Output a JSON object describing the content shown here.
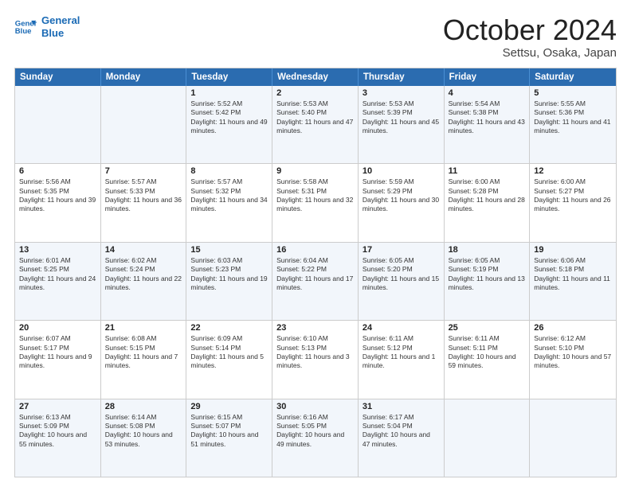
{
  "header": {
    "logo_line1": "General",
    "logo_line2": "Blue",
    "month": "October 2024",
    "location": "Settsu, Osaka, Japan"
  },
  "weekdays": [
    "Sunday",
    "Monday",
    "Tuesday",
    "Wednesday",
    "Thursday",
    "Friday",
    "Saturday"
  ],
  "rows": [
    [
      {
        "day": "",
        "text": ""
      },
      {
        "day": "",
        "text": ""
      },
      {
        "day": "1",
        "text": "Sunrise: 5:52 AM\nSunset: 5:42 PM\nDaylight: 11 hours and 49 minutes."
      },
      {
        "day": "2",
        "text": "Sunrise: 5:53 AM\nSunset: 5:40 PM\nDaylight: 11 hours and 47 minutes."
      },
      {
        "day": "3",
        "text": "Sunrise: 5:53 AM\nSunset: 5:39 PM\nDaylight: 11 hours and 45 minutes."
      },
      {
        "day": "4",
        "text": "Sunrise: 5:54 AM\nSunset: 5:38 PM\nDaylight: 11 hours and 43 minutes."
      },
      {
        "day": "5",
        "text": "Sunrise: 5:55 AM\nSunset: 5:36 PM\nDaylight: 11 hours and 41 minutes."
      }
    ],
    [
      {
        "day": "6",
        "text": "Sunrise: 5:56 AM\nSunset: 5:35 PM\nDaylight: 11 hours and 39 minutes."
      },
      {
        "day": "7",
        "text": "Sunrise: 5:57 AM\nSunset: 5:33 PM\nDaylight: 11 hours and 36 minutes."
      },
      {
        "day": "8",
        "text": "Sunrise: 5:57 AM\nSunset: 5:32 PM\nDaylight: 11 hours and 34 minutes."
      },
      {
        "day": "9",
        "text": "Sunrise: 5:58 AM\nSunset: 5:31 PM\nDaylight: 11 hours and 32 minutes."
      },
      {
        "day": "10",
        "text": "Sunrise: 5:59 AM\nSunset: 5:29 PM\nDaylight: 11 hours and 30 minutes."
      },
      {
        "day": "11",
        "text": "Sunrise: 6:00 AM\nSunset: 5:28 PM\nDaylight: 11 hours and 28 minutes."
      },
      {
        "day": "12",
        "text": "Sunrise: 6:00 AM\nSunset: 5:27 PM\nDaylight: 11 hours and 26 minutes."
      }
    ],
    [
      {
        "day": "13",
        "text": "Sunrise: 6:01 AM\nSunset: 5:25 PM\nDaylight: 11 hours and 24 minutes."
      },
      {
        "day": "14",
        "text": "Sunrise: 6:02 AM\nSunset: 5:24 PM\nDaylight: 11 hours and 22 minutes."
      },
      {
        "day": "15",
        "text": "Sunrise: 6:03 AM\nSunset: 5:23 PM\nDaylight: 11 hours and 19 minutes."
      },
      {
        "day": "16",
        "text": "Sunrise: 6:04 AM\nSunset: 5:22 PM\nDaylight: 11 hours and 17 minutes."
      },
      {
        "day": "17",
        "text": "Sunrise: 6:05 AM\nSunset: 5:20 PM\nDaylight: 11 hours and 15 minutes."
      },
      {
        "day": "18",
        "text": "Sunrise: 6:05 AM\nSunset: 5:19 PM\nDaylight: 11 hours and 13 minutes."
      },
      {
        "day": "19",
        "text": "Sunrise: 6:06 AM\nSunset: 5:18 PM\nDaylight: 11 hours and 11 minutes."
      }
    ],
    [
      {
        "day": "20",
        "text": "Sunrise: 6:07 AM\nSunset: 5:17 PM\nDaylight: 11 hours and 9 minutes."
      },
      {
        "day": "21",
        "text": "Sunrise: 6:08 AM\nSunset: 5:15 PM\nDaylight: 11 hours and 7 minutes."
      },
      {
        "day": "22",
        "text": "Sunrise: 6:09 AM\nSunset: 5:14 PM\nDaylight: 11 hours and 5 minutes."
      },
      {
        "day": "23",
        "text": "Sunrise: 6:10 AM\nSunset: 5:13 PM\nDaylight: 11 hours and 3 minutes."
      },
      {
        "day": "24",
        "text": "Sunrise: 6:11 AM\nSunset: 5:12 PM\nDaylight: 11 hours and 1 minute."
      },
      {
        "day": "25",
        "text": "Sunrise: 6:11 AM\nSunset: 5:11 PM\nDaylight: 10 hours and 59 minutes."
      },
      {
        "day": "26",
        "text": "Sunrise: 6:12 AM\nSunset: 5:10 PM\nDaylight: 10 hours and 57 minutes."
      }
    ],
    [
      {
        "day": "27",
        "text": "Sunrise: 6:13 AM\nSunset: 5:09 PM\nDaylight: 10 hours and 55 minutes."
      },
      {
        "day": "28",
        "text": "Sunrise: 6:14 AM\nSunset: 5:08 PM\nDaylight: 10 hours and 53 minutes."
      },
      {
        "day": "29",
        "text": "Sunrise: 6:15 AM\nSunset: 5:07 PM\nDaylight: 10 hours and 51 minutes."
      },
      {
        "day": "30",
        "text": "Sunrise: 6:16 AM\nSunset: 5:05 PM\nDaylight: 10 hours and 49 minutes."
      },
      {
        "day": "31",
        "text": "Sunrise: 6:17 AM\nSunset: 5:04 PM\nDaylight: 10 hours and 47 minutes."
      },
      {
        "day": "",
        "text": ""
      },
      {
        "day": "",
        "text": ""
      }
    ]
  ],
  "alt_rows": [
    0,
    2,
    4
  ]
}
